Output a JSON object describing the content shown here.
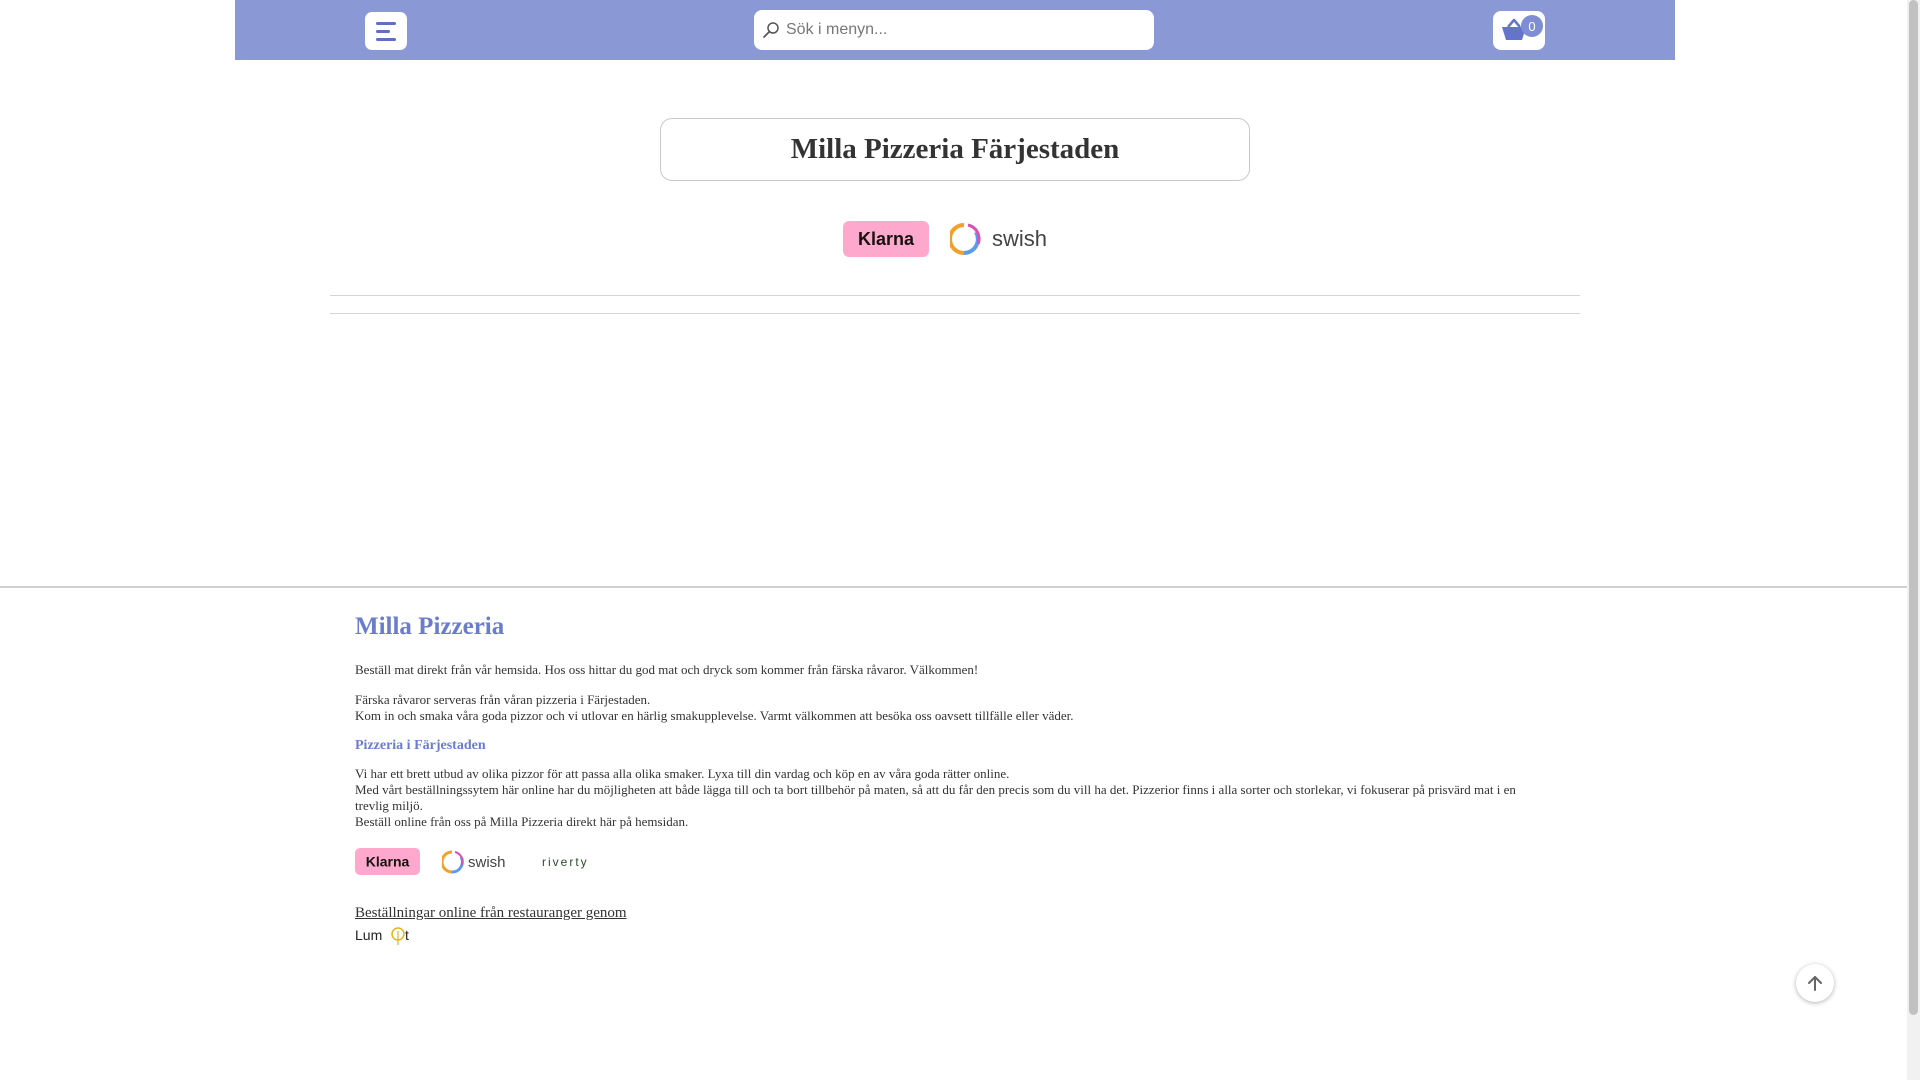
{
  "header": {
    "search_placeholder": "Sök i menyn...",
    "cart_count": "0"
  },
  "main": {
    "title": "Milla Pizzeria Färjestaden",
    "payment_logos": [
      "Klarna",
      "swish"
    ]
  },
  "footer": {
    "heading": "Milla Pizzeria",
    "intro": "Beställ mat direkt från vår hemsida. Hos oss hittar du god mat och dryck som kommer från färska råvaror. Välkommen!",
    "para2_line1": "Färska råvaror serveras från våran pizzeria i Färjestaden.",
    "para2_line2": "Kom in och smaka våra goda pizzor och vi utlovar en härlig smakupplevelse. Varmt välkommen att besöka oss oavsett tillfälle eller väder.",
    "subheading": "Pizzeria i Färjestaden",
    "para3_line1": "Vi har ett brett utbud av olika pizzor för att passa alla olika smaker. Lyxa till din vardag och köp en av våra goda rätter online.",
    "para3_line2": "Med vårt beställningssytem här online har du möjligheten att både lägga till och ta bort tillbehör på maten, så att du får den precis som du vill ha det. Pizzerior finns i alla sorter och storlekar, vi fokuserar på prisvärd mat i en trevlig miljö.",
    "para3_line3": "Beställ online från oss på Milla Pizzeria direkt här på hemsidan.",
    "payment_logos": [
      "Klarna",
      "swish",
      "riverty"
    ],
    "orders_link": "Beställningar online från restauranger genom",
    "provider_logo": "Lumot"
  },
  "colors": {
    "header_bg": "#8a99d6",
    "accent": "#6a7ccf",
    "klarna_pink": "#ffa8cd"
  },
  "icons": [
    "menu-icon",
    "search-icon",
    "basket-icon",
    "arrow-up-icon"
  ]
}
